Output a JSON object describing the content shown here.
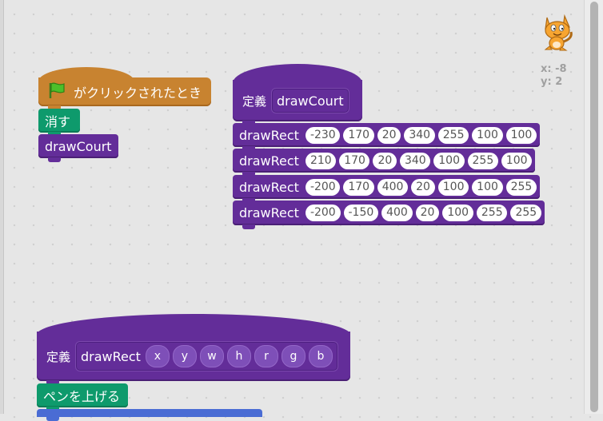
{
  "stage": {
    "sprite": "cat-sprite-icon",
    "x_label": "x: -8",
    "y_label": "y: 2"
  },
  "script1": {
    "hat": {
      "icon": "green-flag-icon",
      "label": "がクリックされたとき"
    },
    "clear": "消す",
    "call": "drawCourt"
  },
  "define_court": {
    "define": "定義",
    "name": "drawCourt",
    "rows": [
      {
        "label": "drawRect",
        "args": [
          "-230",
          "170",
          "20",
          "340",
          "255",
          "100",
          "100"
        ]
      },
      {
        "label": "drawRect",
        "args": [
          "210",
          "170",
          "20",
          "340",
          "100",
          "255",
          "100"
        ]
      },
      {
        "label": "drawRect",
        "args": [
          "-200",
          "170",
          "400",
          "20",
          "100",
          "100",
          "255"
        ]
      },
      {
        "label": "drawRect",
        "args": [
          "-200",
          "-150",
          "400",
          "20",
          "100",
          "255",
          "255"
        ]
      }
    ]
  },
  "define_rect": {
    "define": "定義",
    "name": "drawRect",
    "params": [
      "x",
      "y",
      "w",
      "h",
      "r",
      "g",
      "b"
    ],
    "pen_up": "ペンを上げる"
  },
  "colors": {
    "events": "#c88330",
    "pen": "#0e9a6c",
    "more_blocks": "#632d99",
    "motion": "#4a6cd4"
  }
}
